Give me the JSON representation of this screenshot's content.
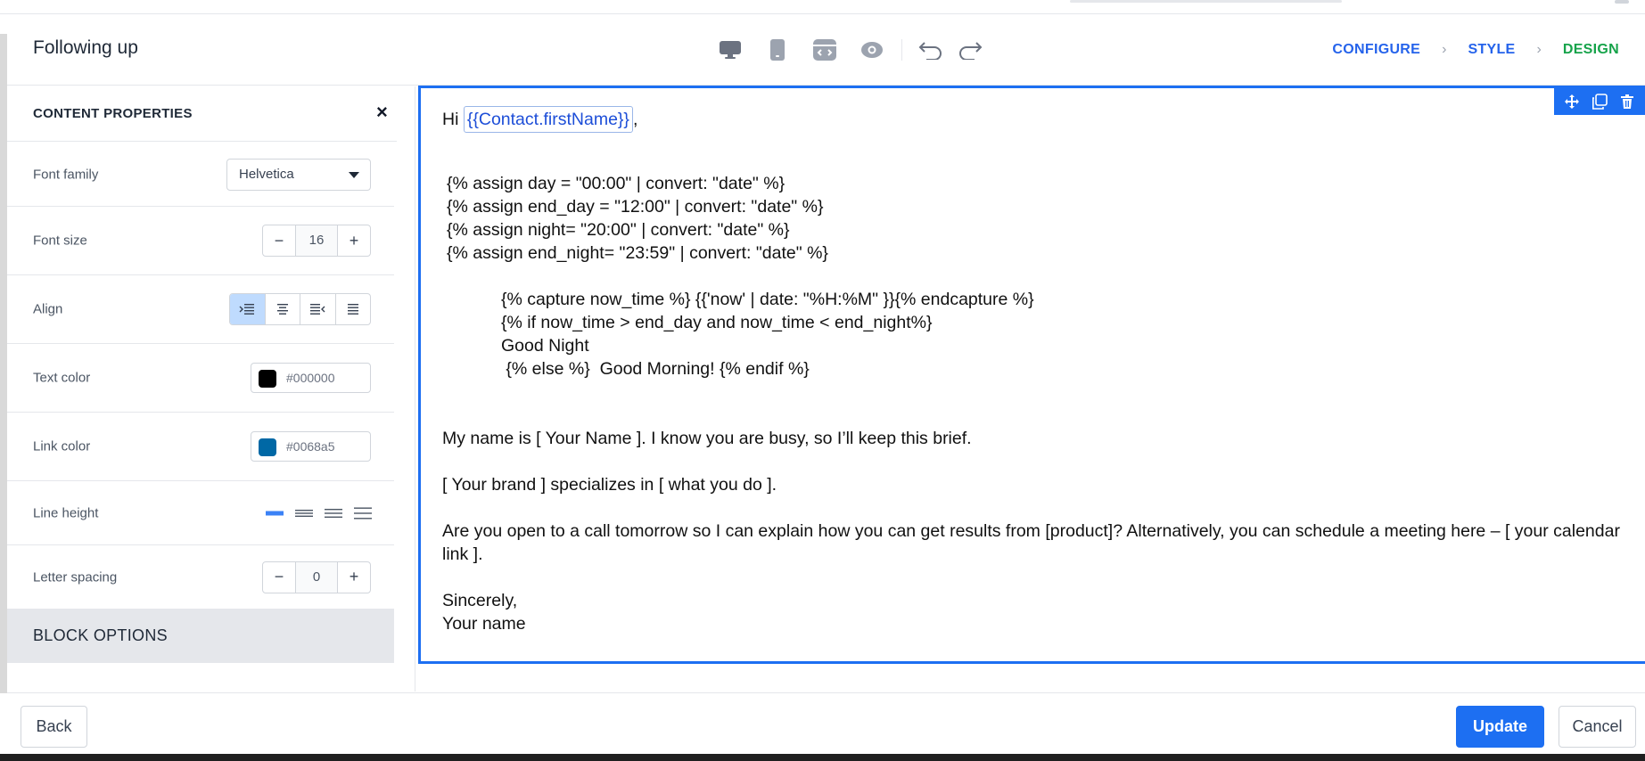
{
  "header": {
    "title": "Following up",
    "toolbar": [
      {
        "name": "desktop-view-icon",
        "label": "Desktop preview"
      },
      {
        "name": "mobile-view-icon",
        "label": "Mobile preview"
      },
      {
        "name": "code-view-icon",
        "label": "Code view"
      },
      {
        "name": "preview-eye-icon",
        "label": "Preview"
      },
      {
        "name": "undo-icon",
        "label": "Undo"
      },
      {
        "name": "redo-icon",
        "label": "Redo"
      }
    ],
    "steps": [
      "CONFIGURE",
      "STYLE",
      "DESIGN"
    ],
    "active_step": "DESIGN"
  },
  "panel": {
    "title": "CONTENT PROPERTIES",
    "close_glyph": "×",
    "font_family": {
      "label": "Font family",
      "value": "Helvetica"
    },
    "font_size": {
      "label": "Font size",
      "value": "16",
      "minus": "−",
      "plus": "+"
    },
    "align": {
      "label": "Align",
      "selected": "left"
    },
    "text_color": {
      "label": "Text color",
      "value": "#000000",
      "swatch": "#000000"
    },
    "link_color": {
      "label": "Link color",
      "value": "#0068a5",
      "swatch": "#0068a5"
    },
    "line_height": {
      "label": "Line height",
      "selected": 0
    },
    "letter_spacing": {
      "label": "Letter spacing",
      "value": "0",
      "minus": "−",
      "plus": "+"
    },
    "block_options": "BLOCK OPTIONS"
  },
  "email": {
    "greeting": "Hi",
    "merge_tag": "{{Contact.firstName}}",
    "greeting_suffix": ",",
    "code_lines": [
      "{% assign day = \"00:00\" | convert: \"date\" %}",
      "{% assign end_day = \"12:00\" | convert: \"date\" %}",
      "{% assign night= \"20:00\" | convert: \"date\" %}",
      "{% assign end_night= \"23:59\" | convert: \"date\" %}"
    ],
    "indented_lines": [
      "{% capture now_time %} {{'now' | date: \"%H:%M\" }}{% endcapture %}",
      "{% if now_time > end_day and now_time < end_night%}",
      "Good Night",
      " {% else %}  Good Morning! {% endif %}"
    ],
    "para1": "My name is [ Your Name ]. I know you are busy, so I’ll keep this brief.",
    "para2": "[ Your brand ] specializes in [ what you do ].",
    "para3": "Are you open to a call tomorrow so I can explain how you can get results from [product]? Alternatively, you can schedule a meeting here – [ your calendar link ].",
    "closing": "Sincerely,",
    "signature": "Your name"
  },
  "footer": {
    "back": "Back",
    "update": "Update",
    "cancel": "Cancel"
  },
  "colors": {
    "accent": "#1d6ff2",
    "step_link": "#2563eb",
    "step_active": "#16a34a"
  }
}
